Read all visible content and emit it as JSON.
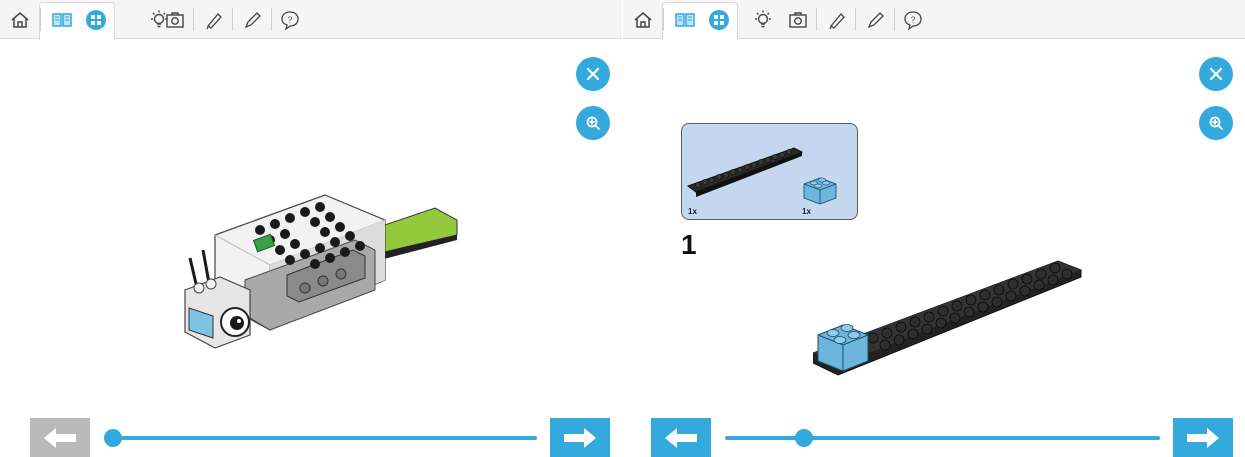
{
  "left_panel": {
    "toolbar": {
      "icons": [
        "home-icon",
        "book-icon",
        "grid-icon",
        "lightbulb-icon",
        "camera-icon",
        "pen-icon",
        "pencil-icon",
        "help-icon"
      ]
    },
    "buttons": {
      "close": "close-icon",
      "zoom": "zoom-in-icon"
    },
    "prev_enabled": false,
    "next_enabled": true,
    "progress": 0.0
  },
  "right_panel": {
    "toolbar": {
      "icons": [
        "home-icon",
        "book-icon",
        "grid-icon",
        "lightbulb-icon",
        "camera-icon",
        "pen-icon",
        "pencil-icon",
        "help-icon"
      ]
    },
    "buttons": {
      "close": "close-icon",
      "zoom": "zoom-in-icon"
    },
    "parts": [
      {
        "name": "black-plate-2x16",
        "count": "1x"
      },
      {
        "name": "blue-brick-2x2",
        "count": "1x"
      }
    ],
    "step_number": "1",
    "prev_enabled": true,
    "next_enabled": true,
    "progress": 0.18
  },
  "colors": {
    "accent": "#33a9dd",
    "disabled": "#b9b9b9",
    "parts_bg": "#c4d7ee"
  }
}
